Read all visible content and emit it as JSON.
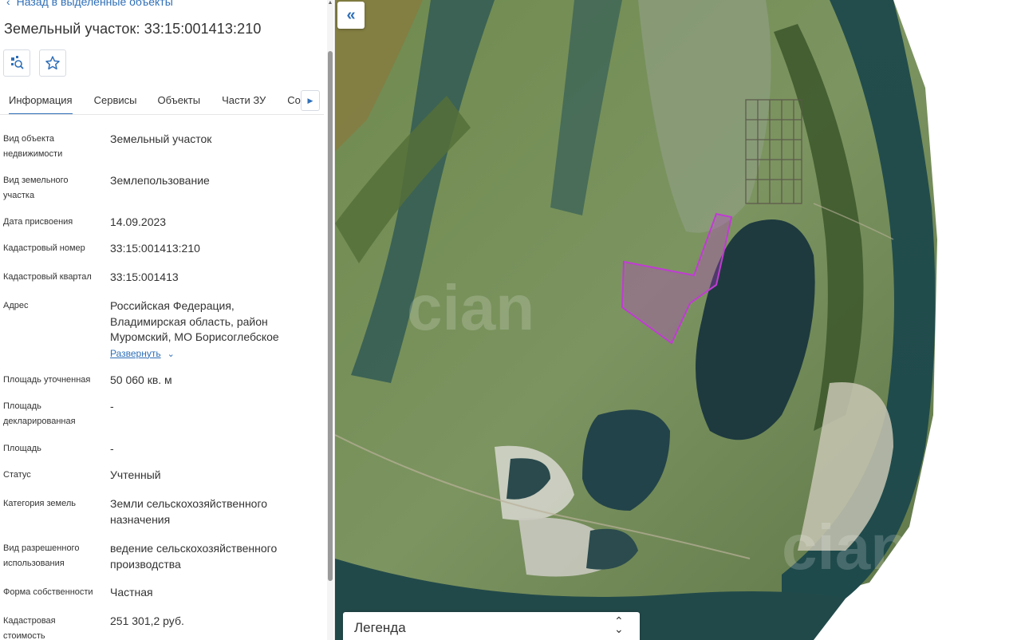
{
  "panel": {
    "back_link": "Назад в выделенные объекты",
    "title": "Земельный участок: 33:15:001413:210",
    "tabs": [
      {
        "label": "Информация",
        "active": true
      },
      {
        "label": "Сервисы",
        "active": false
      },
      {
        "label": "Объекты",
        "active": false
      },
      {
        "label": "Части ЗУ",
        "active": false
      },
      {
        "label": "Соста",
        "active": false
      }
    ],
    "properties": [
      {
        "label": "Вид объекта недвижимости",
        "value": "Земельный участок"
      },
      {
        "label": "Вид земельного участка",
        "value": "Землепользование"
      },
      {
        "label": "Дата присвоения",
        "value": "14.09.2023"
      },
      {
        "label": "Кадастровый номер",
        "value": "33:15:001413:210"
      },
      {
        "label": "Кадастровый квартал",
        "value": "33:15:001413"
      },
      {
        "label": "Адрес",
        "value": "Российская Федерация, Владимирская область, район Муромский, МО Борисоглебское",
        "action": "Развернуть"
      },
      {
        "label": "Площадь уточненная",
        "value": "50 060 кв. м"
      },
      {
        "label": "Площадь декларированная",
        "value": "-"
      },
      {
        "label": "Площадь",
        "value": "-"
      },
      {
        "label": "Статус",
        "value": "Учтенный"
      },
      {
        "label": "Категория земель",
        "value": "Земли сельскохозяйственного назначения"
      },
      {
        "label": "Вид разрешенного использования",
        "value": "ведение сельскохозяйственного производства"
      },
      {
        "label": "Форма собственности",
        "value": "Частная"
      },
      {
        "label": "Кадастровая стоимость",
        "value": "251 301,2 руб."
      }
    ]
  },
  "map": {
    "legend_label": "Легенда",
    "parcel_color": "#c13bd4"
  },
  "icons": {
    "back": "chevron-left-icon",
    "locate": "locate-on-map-icon",
    "favorite": "star-icon",
    "collapse": "double-chevron-left-icon",
    "legend_toggle": "sort-arrows-icon"
  }
}
